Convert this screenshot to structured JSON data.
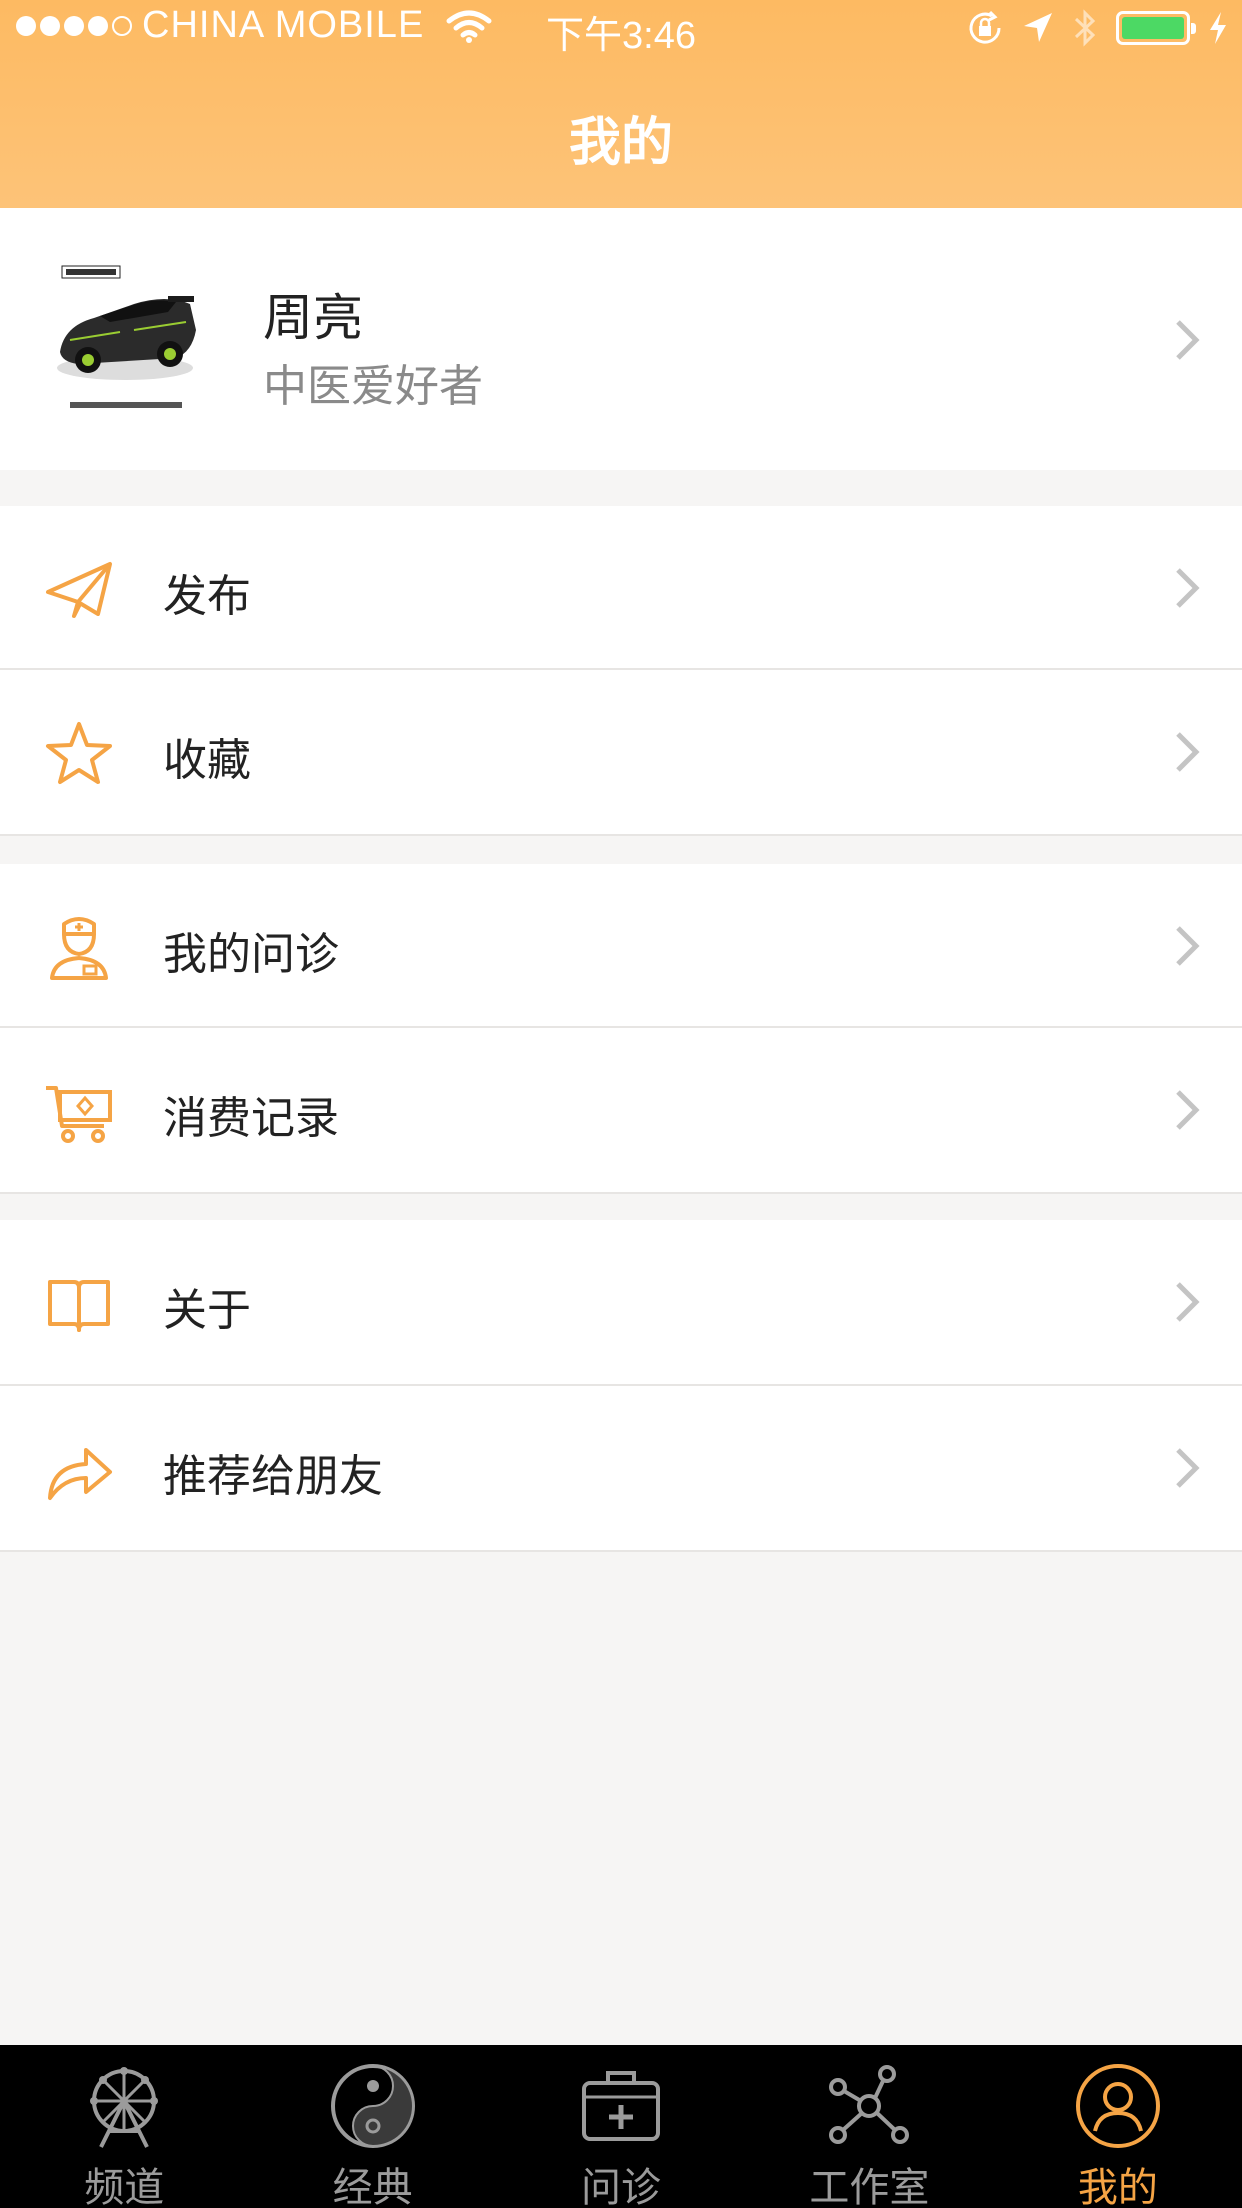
{
  "status_bar": {
    "carrier": "CHINA MOBILE",
    "time": "下午3:46"
  },
  "header": {
    "title": "我的"
  },
  "profile": {
    "name": "周亮",
    "subtitle": "中医爱好者"
  },
  "menu": {
    "publish": "发布",
    "favorites": "收藏",
    "my_consultations": "我的问诊",
    "purchase_history": "消费记录",
    "about": "关于",
    "recommend": "推荐给朋友"
  },
  "tabs": [
    {
      "label": "频道",
      "icon": "ferris-wheel-icon"
    },
    {
      "label": "经典",
      "icon": "yin-yang-icon"
    },
    {
      "label": "问诊",
      "icon": "medical-kit-icon"
    },
    {
      "label": "工作室",
      "icon": "network-icon"
    },
    {
      "label": "我的",
      "icon": "user-circle-icon"
    }
  ],
  "colors": {
    "accent": "#f5a445",
    "header_top": "#fdba62",
    "battery": "#4cd964"
  }
}
